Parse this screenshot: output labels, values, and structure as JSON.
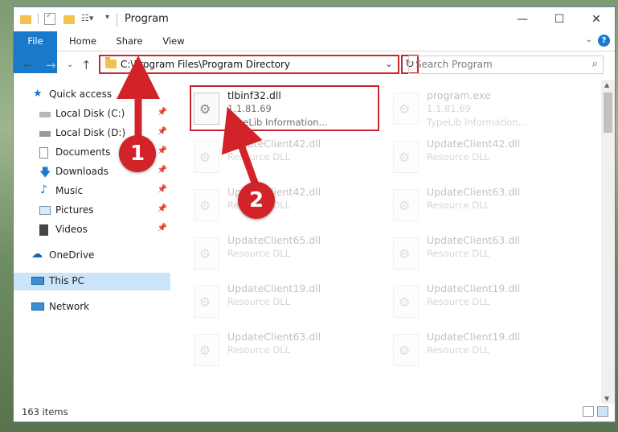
{
  "window": {
    "title": "Program"
  },
  "tabs": {
    "file": "File",
    "home": "Home",
    "share": "Share",
    "view": "View"
  },
  "address": {
    "path": "C:\\Program Files\\Program Directory"
  },
  "search": {
    "placeholder": "Search Program"
  },
  "sidebar": {
    "items": [
      {
        "label": "Quick access"
      },
      {
        "label": "Local Disk (C:)"
      },
      {
        "label": "Local Disk (D:)"
      },
      {
        "label": "Documents"
      },
      {
        "label": "Downloads"
      },
      {
        "label": "Music"
      },
      {
        "label": "Pictures"
      },
      {
        "label": "Videos"
      },
      {
        "label": "OneDrive"
      },
      {
        "label": "This PC"
      },
      {
        "label": "Network"
      }
    ]
  },
  "files": [
    {
      "name": "tlbinf32.dll",
      "version": "1.1.81.69",
      "desc": "TypeLib Information..."
    },
    {
      "name": "program.exe",
      "version": "1.1.81.69",
      "desc": "TypeLib Information..."
    },
    {
      "name": "UpdateClient42.dll",
      "desc": "Resource DLL"
    },
    {
      "name": "UpdateClient42.dll",
      "desc": "Resource DLL"
    },
    {
      "name": "UpdateClient42.dll",
      "desc": "Resource DLL"
    },
    {
      "name": "UpdateClient63.dll",
      "desc": "Resource DLL"
    },
    {
      "name": "UpdateClient65.dll",
      "desc": "Resource DLL"
    },
    {
      "name": "UpdateClient63.dll",
      "desc": "Resource DLL"
    },
    {
      "name": "UpdateClient19.dll",
      "desc": "Resource DLL"
    },
    {
      "name": "UpdateClient19.dll",
      "desc": "Resource DLL"
    },
    {
      "name": "UpdateClient63.dll",
      "desc": "Resource DLL"
    },
    {
      "name": "UpdateClient19.dll",
      "desc": "Resource DLL"
    }
  ],
  "status": {
    "count": "163 items"
  },
  "annotations": {
    "step1": "1",
    "step2": "2"
  },
  "colors": {
    "accent": "#1979ca",
    "annotation": "#d2232a"
  }
}
